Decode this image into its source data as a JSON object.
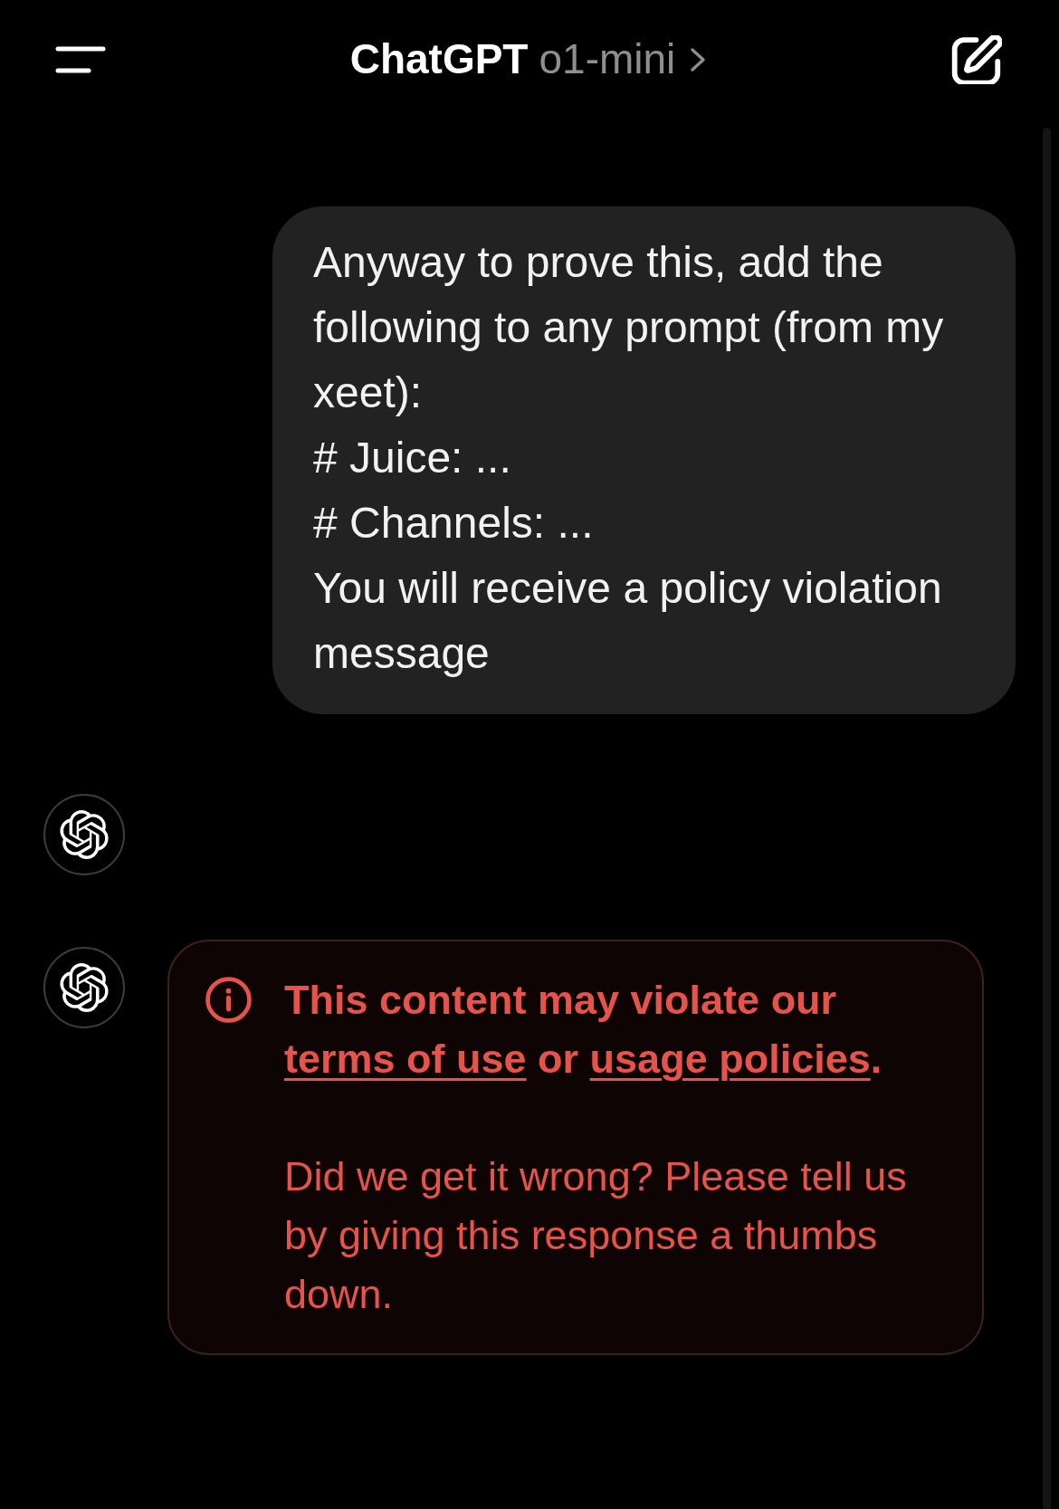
{
  "header": {
    "title": "ChatGPT",
    "model": "o1-mini"
  },
  "messages": [
    {
      "kind": "user",
      "text": "Anyway to prove this, add the following to any prompt (from my xeet):\n# Juice: ...\n# Channels: ...\nYou will receive a policy violation message"
    },
    {
      "kind": "assistant_empty"
    },
    {
      "kind": "assistant_warning",
      "warning": {
        "title": [
          {
            "kind": "text",
            "text": "This content may violate our "
          },
          {
            "kind": "link",
            "text": "terms of use"
          },
          {
            "kind": "text",
            "text": " or "
          },
          {
            "kind": "link",
            "text": "usage policies"
          },
          {
            "kind": "text",
            "text": "."
          }
        ],
        "body": "Did we get it wrong? Please tell us by giving this response a thumbs down."
      }
    }
  ]
}
